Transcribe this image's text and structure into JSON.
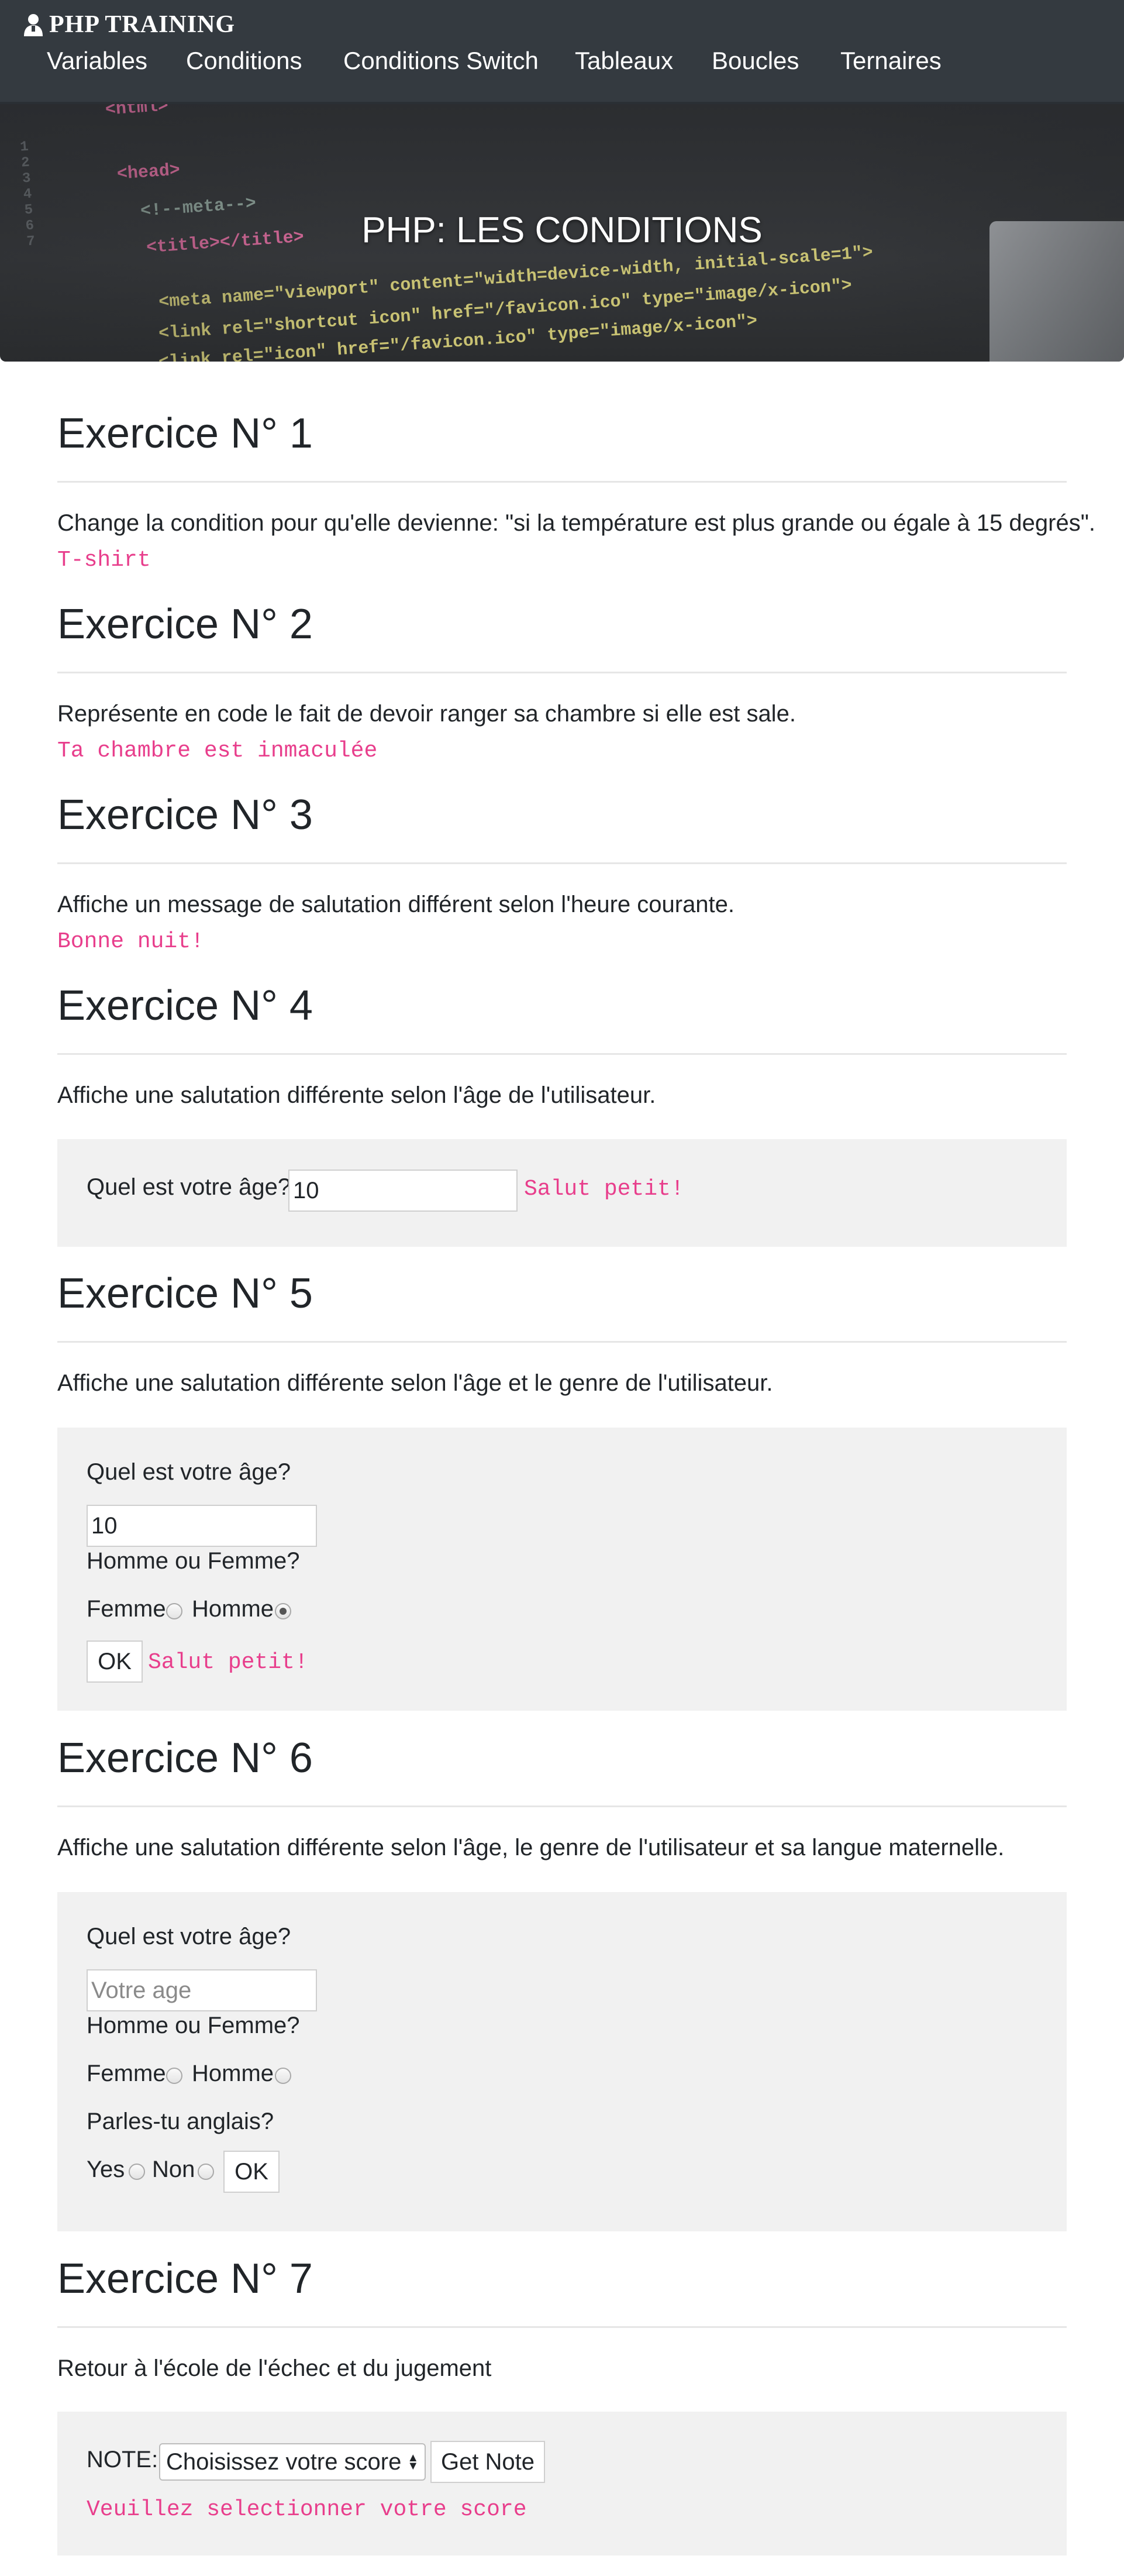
{
  "brand": {
    "icon": "user-icon",
    "title": "PHP TRAINING"
  },
  "nav": {
    "items": [
      "Variables",
      "Conditions",
      "Conditions Switch",
      "Tableaux",
      "Boucles",
      "Ternaires"
    ]
  },
  "hero": {
    "title": "PHP: LES CONDITIONS"
  },
  "exercises": [
    {
      "title": "Exercice N° 1",
      "desc": "Change la condition pour qu'elle devienne: \"si la température est plus grande ou égale à 15 degrés\".",
      "output": "T-shirt"
    },
    {
      "title": "Exercice N° 2",
      "desc": "Représente en code le fait de devoir ranger sa chambre si elle est sale.",
      "output": "Ta chambre est inmaculée"
    },
    {
      "title": "Exercice N° 3",
      "desc": "Affiche un message de salutation différent selon l'heure courante.",
      "output": "Bonne nuit!"
    },
    {
      "title": "Exercice N° 4",
      "desc": "Affiche une salutation différente selon l'âge de l'utilisateur.",
      "age_label": "Quel est votre âge?",
      "age_value": "10",
      "output": "Salut petit!"
    },
    {
      "title": "Exercice N° 5",
      "desc": "Affiche une salutation différente selon l'âge et le genre de l'utilisateur.",
      "age_label": "Quel est votre âge?",
      "age_value": "10",
      "gender_label": "Homme ou Femme?",
      "female": "Femme",
      "male": "Homme",
      "selected": "Homme",
      "ok": "OK",
      "output": "Salut petit!"
    },
    {
      "title": "Exercice N° 6",
      "desc": "Affiche une salutation différente selon l'âge, le genre de l'utilisateur et sa langue maternelle.",
      "age_label": "Quel est votre âge?",
      "age_placeholder": "Votre age",
      "gender_label": "Homme ou Femme?",
      "female": "Femme",
      "male": "Homme",
      "english_label": "Parles-tu anglais?",
      "yes": "Yes",
      "no": "Non",
      "ok": "OK"
    },
    {
      "title": "Exercice N° 7",
      "desc": "Retour à l'école de l'échec et du jugement",
      "note_label": "NOTE:",
      "select_value": "Choisissez votre score",
      "button": "Get Note",
      "output": "Veuillez selectionner votre score"
    }
  ]
}
